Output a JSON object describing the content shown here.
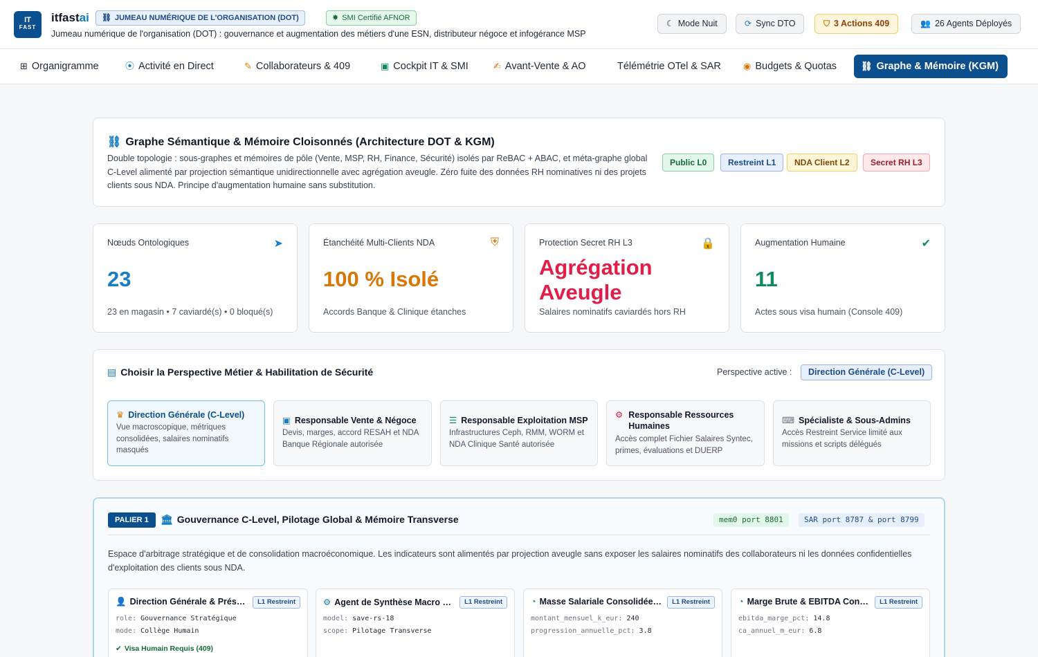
{
  "header": {
    "logo_line1": "IT",
    "logo_line2": "FAST",
    "brand_main": "itfast",
    "brand_ai": "ai",
    "pill_dot": "JUMEAU NUMÉRIQUE DE L'ORGANISATION (DOT)",
    "pill_smi": "SMI Certifié AFNOR",
    "subtitle": "Jumeau numérique de l'organisation (DOT) : gouvernance et augmentation des métiers d'une ESN, distributeur négoce et infogérance MSP",
    "buttons": {
      "night": "Mode Nuit",
      "sync": "Sync DTO",
      "actions": "3 Actions 409",
      "agents": "26 Agents Déployés"
    }
  },
  "tabs": [
    {
      "label": "Organigramme",
      "icon": "sitemap-icon"
    },
    {
      "label": "Activité en Direct",
      "icon": "broadcast-icon"
    },
    {
      "label": "Collaborateurs & 409",
      "icon": "user-edit-icon"
    },
    {
      "label": "Cockpit IT & SMI",
      "icon": "briefcase-icon"
    },
    {
      "label": "Avant-Vente & AO",
      "icon": "file-signature-icon"
    },
    {
      "label": "Télémétrie OTel & SAR",
      "icon": "none"
    },
    {
      "label": "Budgets & Quotas",
      "icon": "coins-icon"
    },
    {
      "label": "Graphe & Mémoire (KGM)",
      "icon": "graph-icon"
    }
  ],
  "intro": {
    "title": "Graphe Sémantique & Mémoire Cloisonnés (Architecture DOT & KGM)",
    "description": "Double topologie : sous-graphes et mémoires de pôle (Vente, MSP, RH, Finance, Sécurité) isolés par ReBAC + ABAC, et méta-graphe global C-Level alimenté par projection sémantique unidirectionnelle avec agrégation aveugle. Zéro fuite des données RH nominatives ni des projets clients sous NDA. Principe d'augmentation humaine sans substitution.",
    "levels": [
      "Public L0",
      "Restreint L1",
      "NDA Client L2",
      "Secret RH L3"
    ]
  },
  "stats": [
    {
      "label": "Nœuds Ontologiques",
      "value": "23",
      "foot": "23 en magasin • 7 caviardé(s) • 0 bloqué(s)",
      "color": "#1a7dc4",
      "icon": "send-icon"
    },
    {
      "label": "Étanchéité Multi-Clients NDA",
      "value": "100 % Isolé",
      "foot": "Accords Banque & Clinique étanches",
      "color": "#d97706",
      "icon": "user-shield-icon"
    },
    {
      "label": "Protection Secret RH L3",
      "value": "Agrégation Aveugle",
      "foot": "Salaires nominatifs caviardés hors RH",
      "color": "#e11d48",
      "icon": "lock-icon"
    },
    {
      "label": "Augmentation Humaine",
      "value": "11",
      "foot": "Actes sous visa humain (Console 409)",
      "color": "#0f8a5f",
      "icon": "user-check-icon"
    }
  ],
  "perspective": {
    "title": "Choisir la Perspective Métier & Habilitation de Sécurité",
    "active_label": "Perspective active :",
    "active_value": "Direction Générale (C-Level)",
    "options": [
      {
        "title": "Direction Générale (C-Level)",
        "desc": "Vue macroscopique, métriques consolidées, salaires nominatifs masqués",
        "icon": "crown-icon"
      },
      {
        "title": "Responsable Vente & Négoce",
        "desc": "Devis, marges, accord RESAH et NDA Banque Régionale autorisée",
        "icon": "briefcase-icon"
      },
      {
        "title": "Responsable Exploitation MSP",
        "desc": "Infrastructures Ceph, RMM, WORM et NDA Clinique Santé autorisée",
        "icon": "server-icon"
      },
      {
        "title": "Responsable Ressources Humaines",
        "desc": "Accès complet Fichier Salaires Syntec, primes, évaluations et DUERP",
        "icon": "users-cog-icon"
      },
      {
        "title": "Spécialiste & Sous-Admins",
        "desc": "Accès Restreint Service limité aux missions et scripts délégués",
        "icon": "terminal-icon"
      }
    ]
  },
  "tier": {
    "badge": "PALIER 1",
    "title": "Gouvernance C-Level, Pilotage Global & Mémoire Transverse",
    "tag_mem": "mem0 port 8801",
    "tag_sar": "SAR port 8787 & port 8799",
    "description": "Espace d'arbitrage stratégique et de consolidation macroéconomique. Les indicateurs sont alimentés par projection aveugle sans exposer les salaires nominatifs des collaborateurs ni les données confidentielles d'exploitation des clients sous NDA.",
    "nodes": [
      {
        "title": "Direction Générale & Préside...",
        "badge": "L1 Restreint",
        "k1": "role:",
        "v1": "Gouvernance Stratégique",
        "k2": "mode:",
        "v2": "Collège Humain",
        "visa": "Visa Humain Requis (409)",
        "icon": "user-icon"
      },
      {
        "title": "Agent de Synthèse Macro C...",
        "badge": "L1 Restreint",
        "k1": "model:",
        "v1": "save-rs-18",
        "k2": "scope:",
        "v2": "Pilotage Transverse",
        "visa": "",
        "icon": "robot-icon"
      },
      {
        "title": "Masse Salariale Consolidée ...",
        "badge": "L1 Restreint",
        "k1": "montant_mensuel_k_eur:",
        "v1": "240",
        "k2": "progression_annuelle_pct:",
        "v2": "3.8",
        "visa": "",
        "icon": "pie-chart-icon"
      },
      {
        "title": "Marge Brute & EBITDA Cons...",
        "badge": "L1 Restreint",
        "k1": "ebitda_marge_pct:",
        "v1": "14.8",
        "k2": "ca_annuel_m_eur:",
        "v2": "6.8",
        "visa": "",
        "icon": "pie-chart-icon"
      }
    ]
  }
}
